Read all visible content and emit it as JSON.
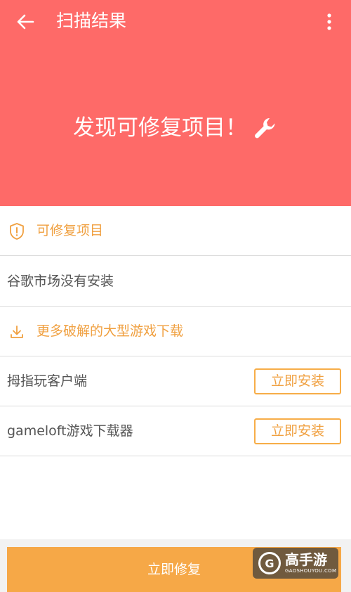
{
  "toolbar": {
    "title": "扫描结果",
    "back_icon": "arrow-left-icon",
    "more_icon": "more-vertical-icon"
  },
  "header": {
    "headline": "发现可修复项目！",
    "headline_icon": "wrench-icon",
    "background_color": "#fe6a68"
  },
  "sections": {
    "repairable": {
      "label": "可修复项目",
      "icon": "shield-alert-icon"
    },
    "missing_item": {
      "label": "谷歌市场没有安装"
    },
    "downloads": {
      "label": "更多破解的大型游戏下载",
      "icon": "download-icon"
    }
  },
  "apps": [
    {
      "name": "拇指玩客户端",
      "button_label": "立即安装"
    },
    {
      "name": "gameloft游戏下载器",
      "button_label": "立即安装"
    }
  ],
  "footer": {
    "repair_label": "立即修复",
    "accent_color": "#f6a847"
  },
  "watermark": {
    "name": "高手游",
    "sub": "GAOSHOUYOU.COM",
    "logo": "G"
  }
}
